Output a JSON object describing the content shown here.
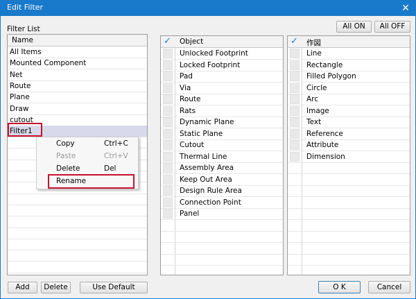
{
  "window": {
    "title": "Edit Filter",
    "close_symbol": "✕"
  },
  "filter_list": {
    "label": "Filter List",
    "header": "Name",
    "items": [
      "All Items",
      "Mounted Component",
      "Net",
      "Route",
      "Plane",
      "Draw",
      "cutout",
      "Filter1"
    ],
    "selected": "Filter1"
  },
  "context_menu": {
    "items": [
      {
        "label": "Copy",
        "shortcut": "Ctrl+C",
        "enabled": true
      },
      {
        "label": "Paste",
        "shortcut": "Ctrl+V",
        "enabled": false
      },
      {
        "label": "Delete",
        "shortcut": "Del",
        "enabled": true
      },
      {
        "label": "Rename",
        "shortcut": "",
        "enabled": true
      }
    ]
  },
  "object_panel": {
    "header_check": "✓",
    "header": "Object",
    "items": [
      "Unlocked Footprint",
      "Locked Footprint",
      "Pad",
      "Via",
      "Route",
      "Rats",
      "Dynamic Plane",
      "Static Plane",
      "Cutout",
      "Thermal Line",
      "Assembly Area",
      "Keep Out Area",
      "Design Rule Area",
      "Connection Point",
      "Panel"
    ]
  },
  "drawing_panel": {
    "header_check": "✓",
    "header": "作図",
    "items": [
      "Line",
      "Rectangle",
      "Filled Polygon",
      "Circle",
      "Arc",
      "Image",
      "Text",
      "Reference",
      "Attribute",
      "Dimension"
    ]
  },
  "buttons": {
    "all_on": "All ON",
    "all_off": "All OFF",
    "add": "Add",
    "delete": "Delete",
    "use_default": "Use Default",
    "ok": "O K",
    "cancel": "Cancel"
  },
  "colors": {
    "accent": "#1979ca",
    "highlight": "#c8102e",
    "selected_row": "#d9d9ec"
  }
}
